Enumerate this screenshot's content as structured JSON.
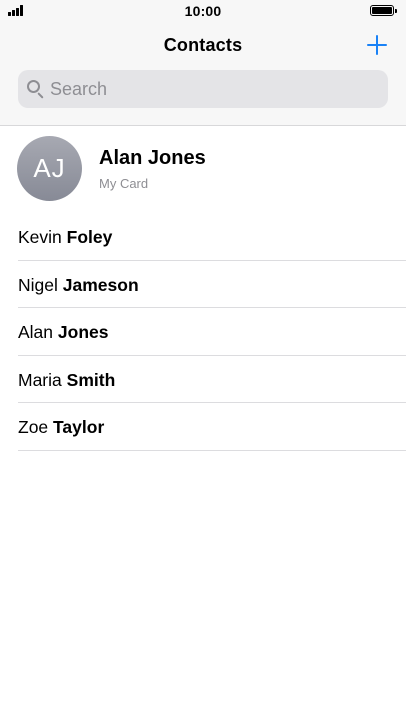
{
  "status_bar": {
    "time": "10:00",
    "signal_icon": "cellular-signal-icon",
    "battery_icon": "battery-icon"
  },
  "nav": {
    "title": "Contacts",
    "add_icon": "plus-icon"
  },
  "search": {
    "placeholder": "Search",
    "value": "",
    "icon": "magnifier-icon"
  },
  "my_card": {
    "initials": "AJ",
    "name": "Alan Jones",
    "subtitle": "My Card"
  },
  "contacts": [
    {
      "first": "Kevin",
      "last": "Foley"
    },
    {
      "first": "Nigel",
      "last": "Jameson"
    },
    {
      "first": "Alan",
      "last": "Jones"
    },
    {
      "first": "Maria",
      "last": "Smith"
    },
    {
      "first": "Zoe",
      "last": "Taylor"
    }
  ],
  "colors": {
    "accent": "#1a82f6",
    "secondary_text": "#8e8e93",
    "avatar_gray": "#8f929e"
  }
}
